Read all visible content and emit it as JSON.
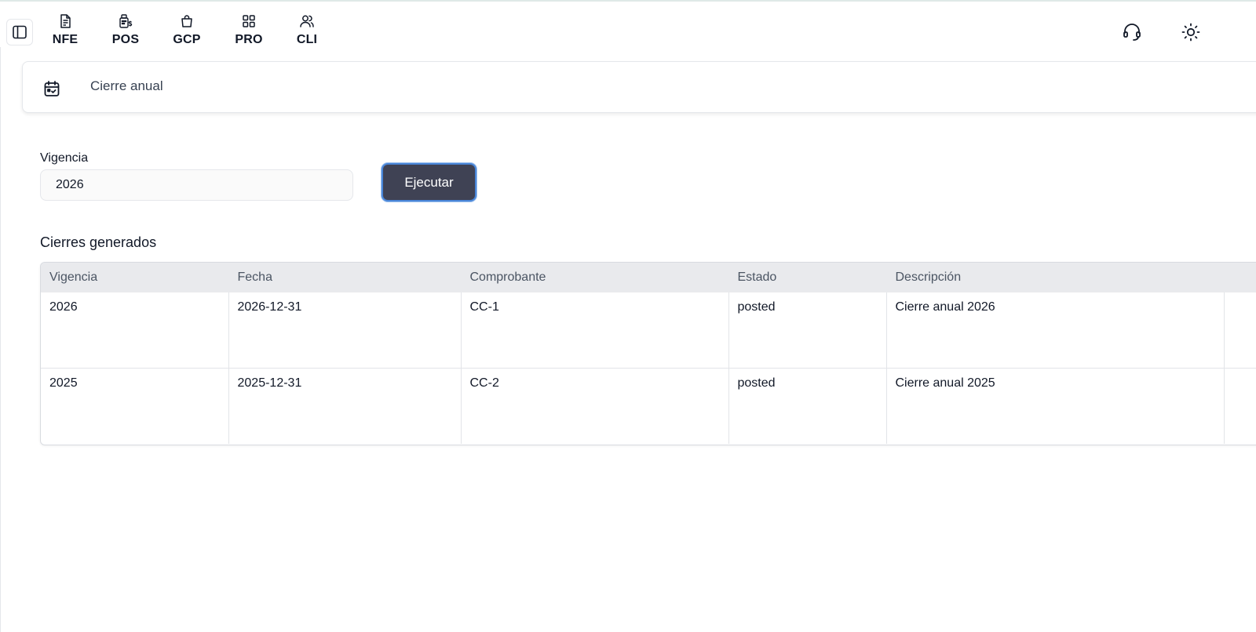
{
  "nav": {
    "modules": [
      {
        "label": "NFE",
        "icon": "document-icon"
      },
      {
        "label": "POS",
        "icon": "cash-register-icon"
      },
      {
        "label": "GCP",
        "icon": "shopping-bag-icon"
      },
      {
        "label": "PRO",
        "icon": "grid-icon"
      },
      {
        "label": "CLI",
        "icon": "users-icon"
      }
    ],
    "right_icons": [
      "headset-icon",
      "sun-icon"
    ]
  },
  "breadcrumb": {
    "icon": "calendar-icon",
    "title": "Cierre anual"
  },
  "form": {
    "vigencia_label": "Vigencia",
    "vigencia_value": "2026",
    "run_label": "Ejecutar"
  },
  "closings": {
    "title": "Cierres generados",
    "columns": [
      "Vigencia",
      "Fecha",
      "Comprobante",
      "Estado",
      "Descripción"
    ],
    "rows": [
      {
        "vigencia": "2026",
        "fecha": "2026-12-31",
        "comprobante": "CC-1",
        "estado": "posted",
        "descripcion": "Cierre anual 2026"
      },
      {
        "vigencia": "2025",
        "fecha": "2025-12-31",
        "comprobante": "CC-2",
        "estado": "posted",
        "descripcion": "Cierre anual 2025"
      }
    ]
  },
  "colors": {
    "button_bg": "#3f4254",
    "button_border": "#4a86d8",
    "table_header_bg": "#e9eaed"
  }
}
